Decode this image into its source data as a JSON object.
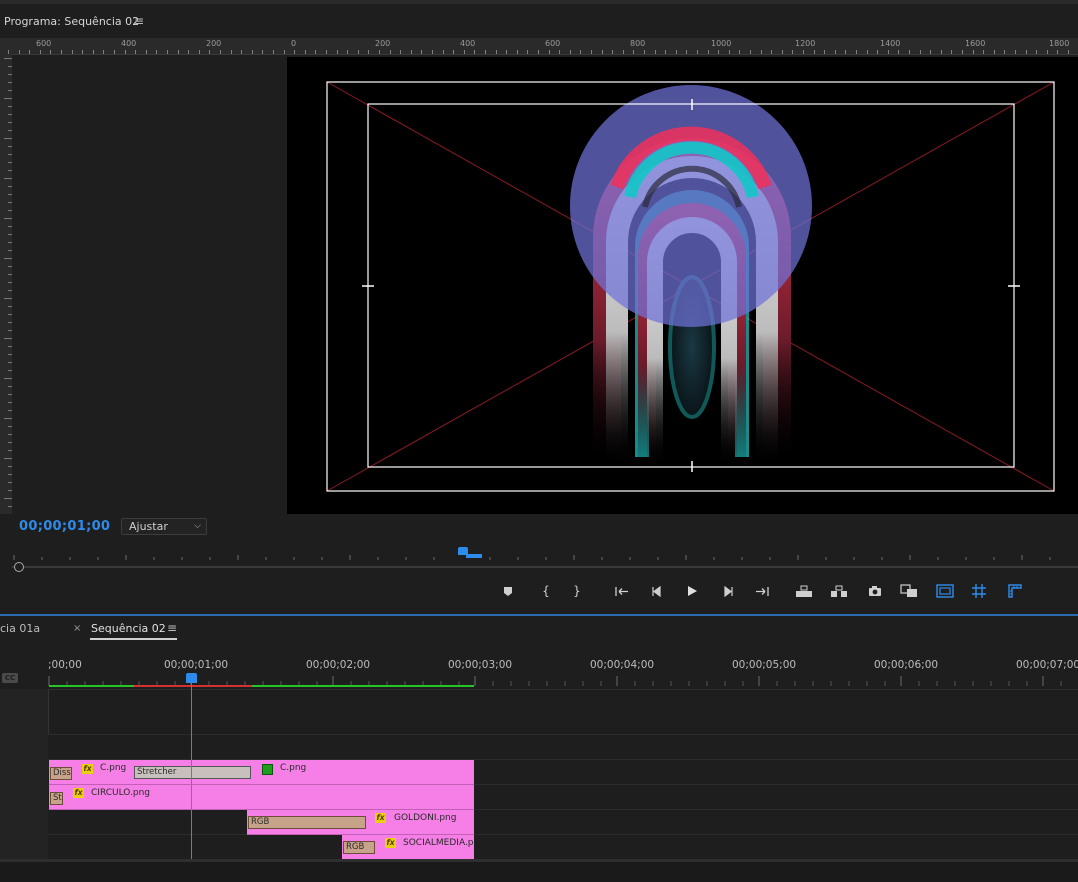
{
  "program_monitor": {
    "title": "Programa: Sequência 02",
    "menu_icon": "≡",
    "ruler_labels": [
      "600",
      "400",
      "200",
      "0",
      "200",
      "400",
      "600",
      "800",
      "1000",
      "1200",
      "1400",
      "1600",
      "1800"
    ],
    "timecode": "00;00;01;00",
    "zoom_select": "Ajustar"
  },
  "transport": {
    "buttons": [
      "add-marker-icon",
      "mark-in-icon",
      "mark-out-icon",
      "go-to-in-icon",
      "step-back-icon",
      "play-icon",
      "step-forward-icon",
      "go-to-out-icon",
      "lift-icon",
      "extract-icon",
      "export-frame-icon",
      "comparison-view-icon",
      "safe-margins-icon",
      "grid-icon",
      "guides-icon"
    ]
  },
  "timeline": {
    "tab_prev": "cia 01a",
    "tab_close": "×",
    "tab_active": "Sequência 02",
    "tab_menu": "≡",
    "timecodes": [
      ";00;00",
      "00;00;01;00",
      "00;00;02;00",
      "00;00;03;00",
      "00;00;04;00",
      "00;00;05;00",
      "00;00;06;00",
      "00;00;07;00"
    ],
    "tracks": [
      {
        "clips": [
          {
            "name": "C.png",
            "fx": "fx",
            "transition": "Diss"
          },
          {
            "name": "C.png"
          }
        ],
        "effect_label": "Stretcher"
      },
      {
        "clips": [
          {
            "name": "CIRCULO.png",
            "fx": "fx",
            "transition": "St"
          }
        ]
      },
      {
        "clips": [
          {
            "name": "GOLDONI.png",
            "fx": "fx",
            "transition": "RGB"
          }
        ]
      },
      {
        "clips": [
          {
            "name": "SOCIALMEDIA.p",
            "fx": "fx",
            "transition": "RGB"
          }
        ]
      }
    ]
  },
  "colors": {
    "accent": "#2d8ceb",
    "clip": "#f57fe6",
    "workarea_green": "#26c426",
    "workarea_red": "#d23232"
  }
}
